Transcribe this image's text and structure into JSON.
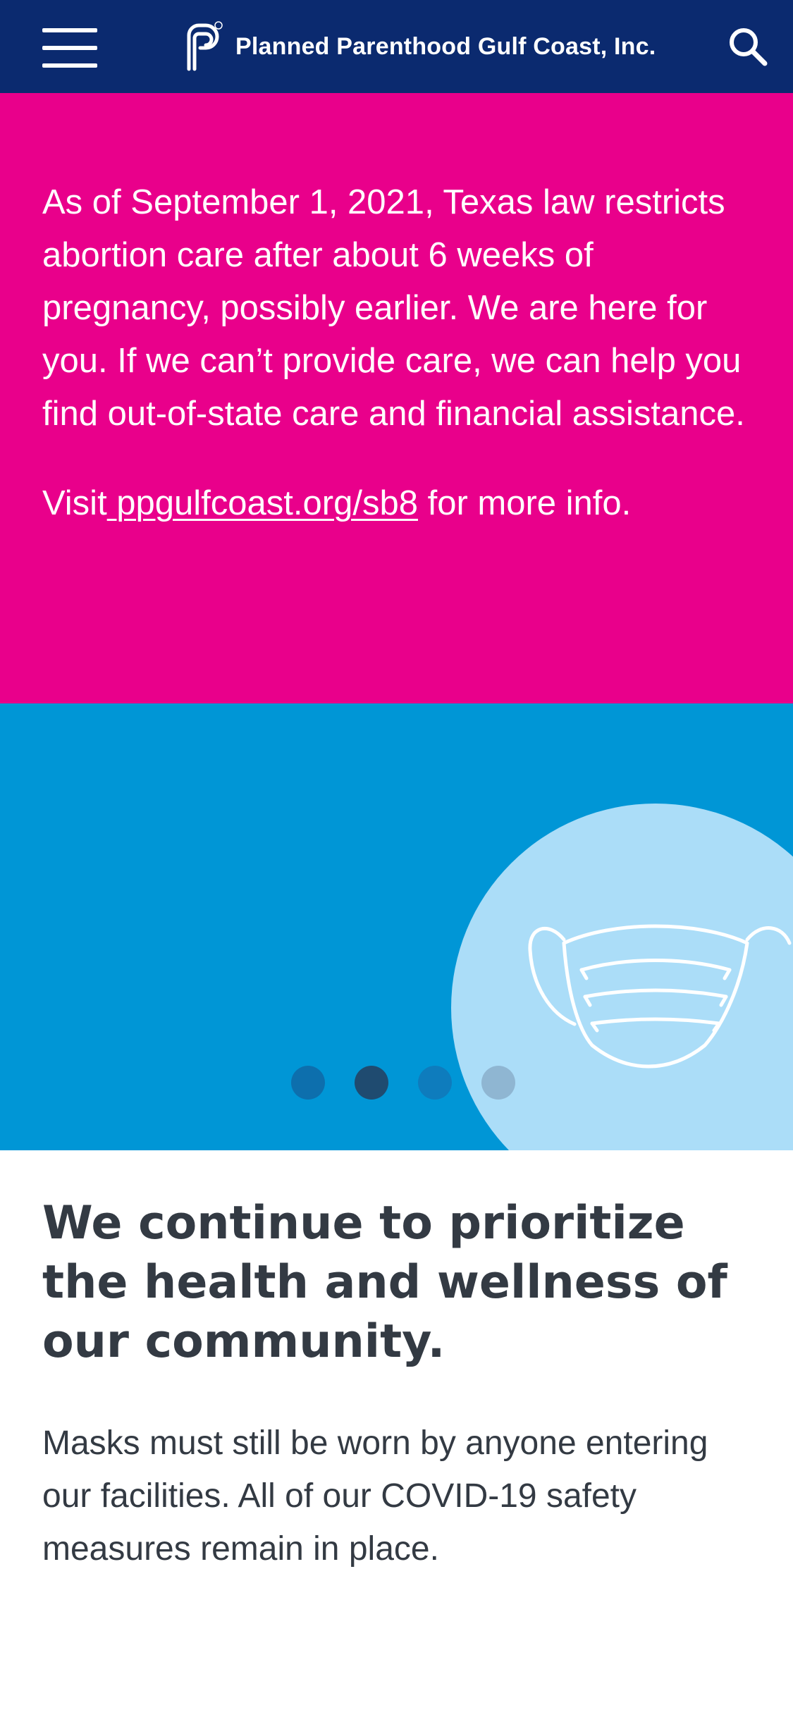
{
  "header": {
    "brand_text": "Planned Parenthood Gulf Coast, Inc.",
    "menu_icon": "hamburger-menu-icon",
    "search_icon": "search-icon",
    "logo_icon": "planned-parenthood-logo-icon",
    "background_color": "#0b2a6f"
  },
  "alert": {
    "body": "As of September 1, 2021, Texas law restricts abortion care after about 6 weeks of pregnancy, possibly earlier. We are here for you. If we can’t provide care, we can help you find out-of-state care and financial assistance.",
    "visit_prefix": "Visit",
    "visit_link": " ppgulfcoast.org/sb8",
    "visit_suffix": " for more info.",
    "background_color": "#e9008b"
  },
  "hero": {
    "illustration_icon": "face-mask-icon",
    "background_color": "#0096d6",
    "circle_color": "#abddf8",
    "carousel": {
      "slide_count": 4,
      "active_slide": 2
    }
  },
  "content": {
    "headline": "We continue to prioritize the health and wellness of our community.",
    "body": "Masks must still be worn by anyone entering our facilities. All of our COVID-19 safety measures remain in place.",
    "text_color": "#333a43"
  }
}
